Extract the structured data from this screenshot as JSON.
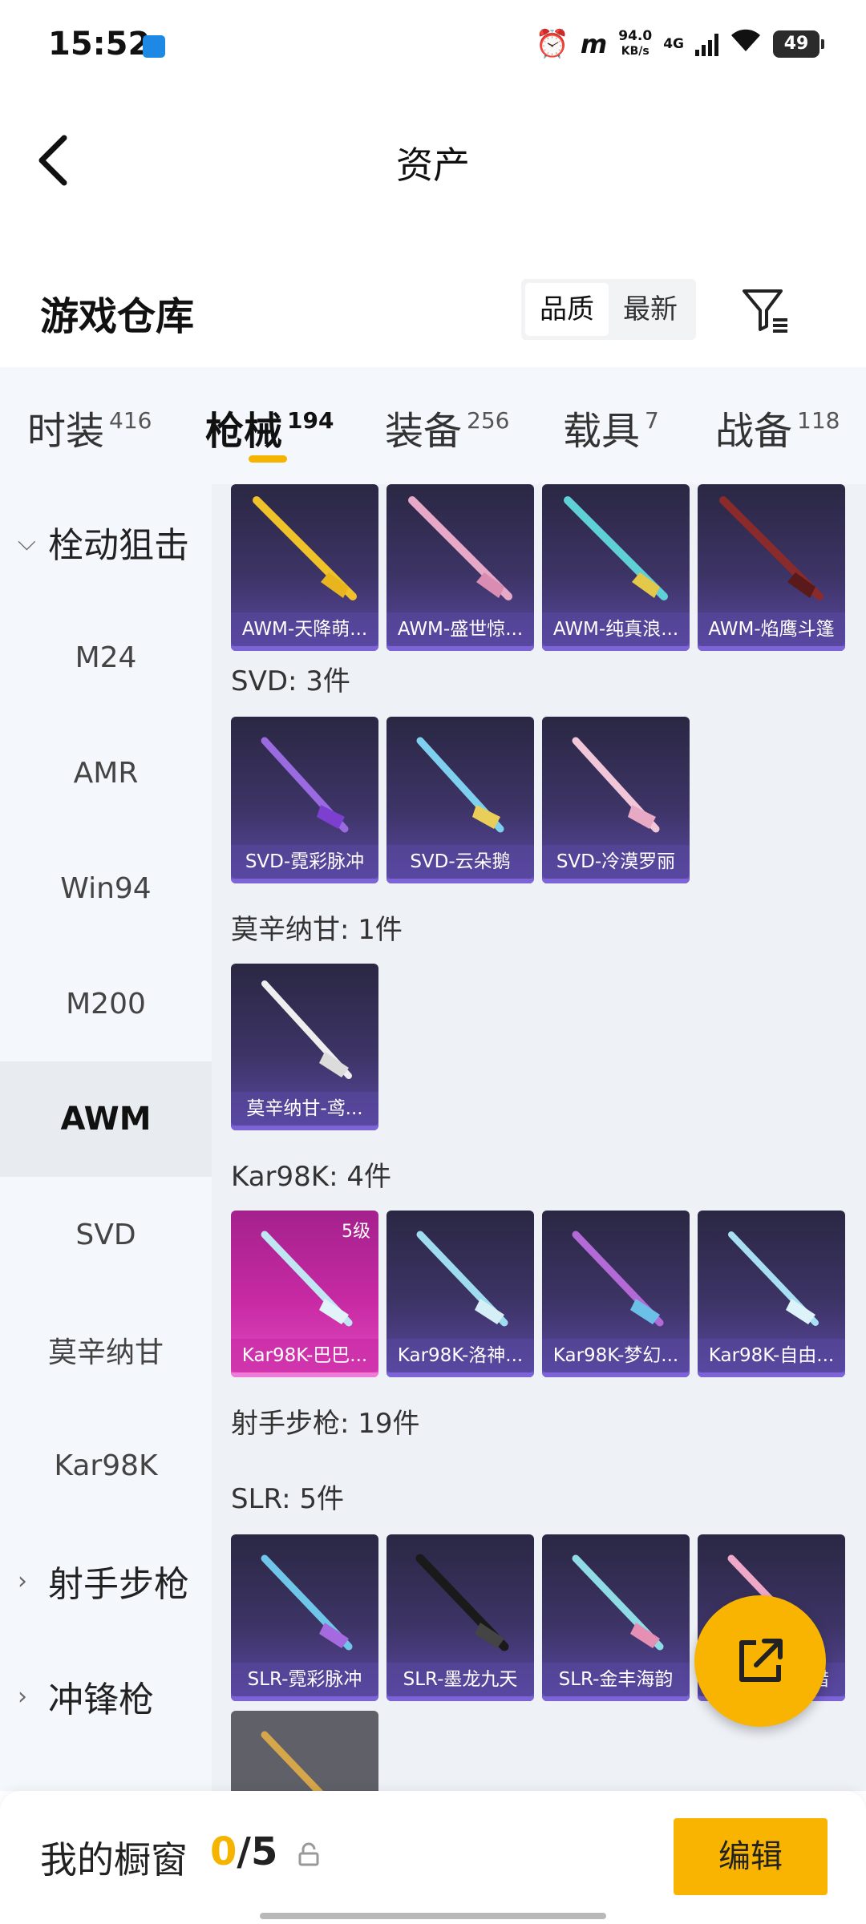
{
  "status_bar": {
    "time": "15:52",
    "net_speed_value": "94.0",
    "net_speed_unit": "KB/s",
    "network": "4G",
    "battery": "49",
    "icons": [
      "alarm-icon",
      "app-icon",
      "signal-icon",
      "wifi-icon",
      "battery-icon"
    ]
  },
  "header": {
    "title": "资产"
  },
  "warehouse": {
    "title": "游戏仓库",
    "sort_options": [
      "品质",
      "最新"
    ],
    "sort_selected": "品质"
  },
  "tabs": [
    {
      "label": "时装",
      "count": "416"
    },
    {
      "label": "枪械",
      "count": "194",
      "active": true
    },
    {
      "label": "装备",
      "count": "256"
    },
    {
      "label": "载具",
      "count": "7"
    },
    {
      "label": "战备",
      "count": "118"
    }
  ],
  "sidebar": {
    "groups": [
      {
        "label": "栓动狙击",
        "expanded": true
      },
      {
        "label": "射手步枪",
        "expanded": false
      },
      {
        "label": "冲锋枪",
        "expanded": false
      }
    ],
    "items": [
      "M24",
      "AMR",
      "Win94",
      "M200",
      "AWM",
      "SVD",
      "莫辛纳甘",
      "Kar98K"
    ],
    "active_item": "AWM"
  },
  "sections": {
    "svd": {
      "label": "SVD: 3件"
    },
    "mosin": {
      "label": "莫辛纳甘: 1件"
    },
    "kar98k": {
      "label": "Kar98K: 4件"
    },
    "marksman": {
      "label": "射手步枪: 19件"
    },
    "slr": {
      "label": "SLR: 5件"
    }
  },
  "cards": {
    "awm": [
      "AWM-天降萌...",
      "AWM-盛世惊...",
      "AWM-纯真浪...",
      "AWM-焰鹰斗篷"
    ],
    "svd": [
      "SVD-霓彩脉冲",
      "SVD-云朵鹅",
      "SVD-冷漠罗丽"
    ],
    "mosin": [
      "莫辛纳甘-鸢..."
    ],
    "kar98k": [
      "Kar98K-巴巴...",
      "Kar98K-洛神...",
      "Kar98K-梦幻...",
      "Kar98K-自由..."
    ],
    "kar98k_level": "5级",
    "slr": [
      "SLR-霓彩脉冲",
      "SLR-墨龙九天",
      "SLR-金丰海韵",
      "猎"
    ]
  },
  "bottom": {
    "showcase_label": "我的橱窗",
    "showcase_current": "0",
    "showcase_sep": "/",
    "showcase_total": "5",
    "edit_label": "编辑"
  },
  "colors": {
    "accent": "#f8b400",
    "card_purple": "#5a48a3",
    "card_pink": "#c82aa4"
  }
}
